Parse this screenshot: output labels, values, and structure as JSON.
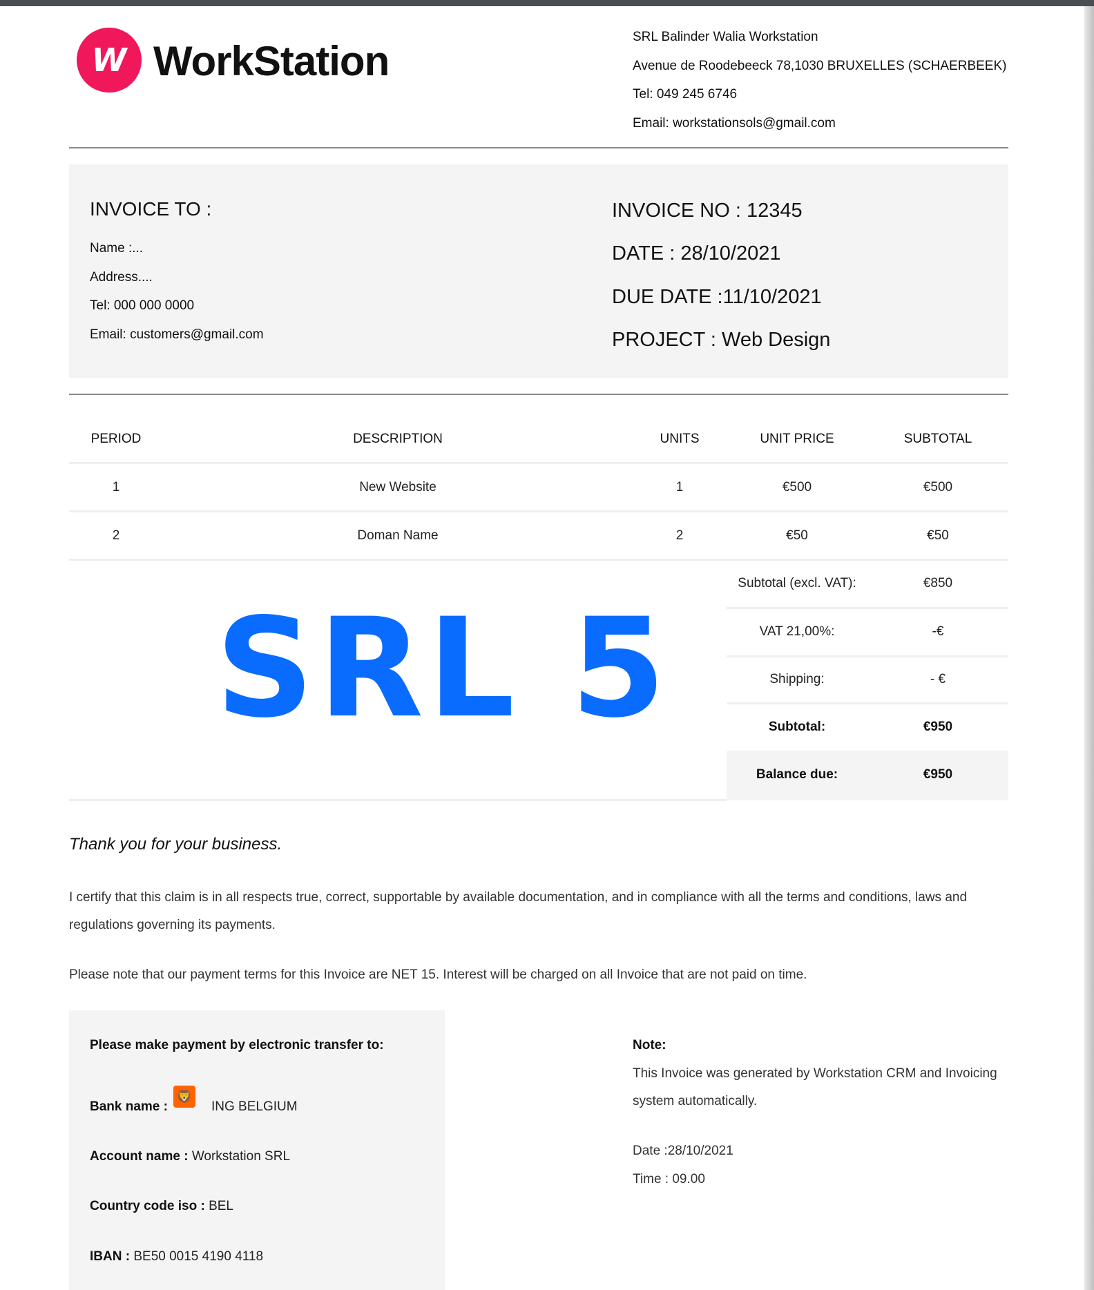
{
  "logo": {
    "mark": "W",
    "name": "WorkStation",
    "brand_color": "#f0185a"
  },
  "company": {
    "name": "SRL Balinder Walia Workstation",
    "address": "Avenue de Roodebeeck 78,1030 BRUXELLES (SCHAERBEEK)",
    "tel": "Tel: 049 245 6746",
    "email": "Email: workstationsols@gmail.com"
  },
  "invoice_to": {
    "title": "INVOICE TO :",
    "name": "Name :...",
    "address": "Address....",
    "tel": "Tel: 000 000 0000",
    "email": "Email: customers@gmail.com"
  },
  "invoice_info": {
    "number": "INVOICE NO : 12345",
    "date": "DATE : 28/10/2021",
    "due_date": "DUE DATE :11/10/2021",
    "project": "PROJECT : Web Design"
  },
  "table": {
    "headers": [
      "PERIOD",
      "DESCRIPTION",
      "UNITS",
      "UNIT PRICE",
      "SUBTOTAL"
    ],
    "rows": [
      [
        "1",
        "New Website",
        "1",
        "€500",
        "€500"
      ],
      [
        "2",
        "Doman Name",
        "2",
        "€50",
        "€50"
      ]
    ]
  },
  "totals": {
    "subtotal_excl_label": "Subtotal (excl. VAT):",
    "subtotal_excl_value": "€850",
    "vat_label": "VAT 21,00%:",
    "vat_value": "-€",
    "shipping_label": "Shipping:",
    "shipping_value": "- €",
    "subtotal_label": "Subtotal:",
    "subtotal_value": "€950",
    "balance_label": "Balance due:",
    "balance_value": "€950"
  },
  "watermark": {
    "text": "SRL 5",
    "color": "#0a6cff"
  },
  "thanks": "Thank you for your business.",
  "certify": "I certify that this claim is in all respects true, correct, supportable by available documentation, and in compliance with all the terms and conditions, laws and regulations governing its payments.",
  "terms": "Please note that our payment terms for this Invoice are NET 15. Interest will be charged on all Invoice that are not paid on time.",
  "payment": {
    "heading": "Please make payment by electronic transfer to:",
    "bank_label": "Bank name :",
    "bank_icon": "ing-lion-icon",
    "bank_value": "ING BELGIUM",
    "account_label": "Account name :",
    "account_value": "Workstation SRL",
    "country_label": "Country code iso :",
    "country_value": "BEL",
    "iban_label": "IBAN :",
    "iban_value": "BE50 0015 4190 4118"
  },
  "note": {
    "title": "Note:",
    "line1": "This Invoice was generated by Workstation CRM and Invoicing",
    "line2": "system automatically.",
    "date": "Date :28/10/2021",
    "time": "Time : 09.00"
  }
}
